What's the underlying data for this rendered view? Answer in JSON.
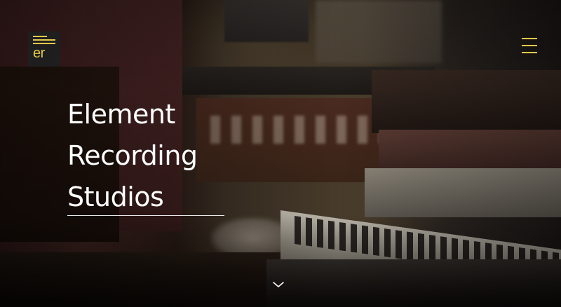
{
  "site": {
    "logo_text": "er",
    "logo_color": "#e2c84a"
  },
  "header": {
    "menu_icon": "hamburger-menu-icon",
    "menu_color": "#e2c84a"
  },
  "hero": {
    "title_lines": [
      "Element",
      "Recording",
      "Studios"
    ],
    "title_color": "#ffffff"
  },
  "scroll": {
    "icon": "chevron-down-icon"
  }
}
